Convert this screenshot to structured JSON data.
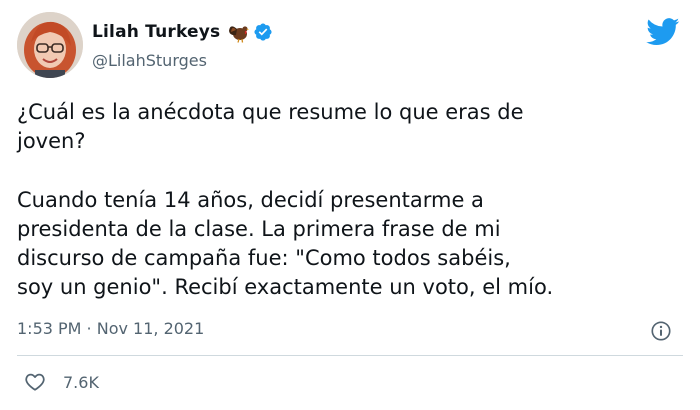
{
  "author": {
    "display_name": "Lilah Turkeys",
    "emoji_icon": "turkey-icon",
    "verified": true,
    "handle": "@LilahSturges"
  },
  "brand": {
    "icon": "twitter-bird-icon",
    "color": "#1d9bf0"
  },
  "tweet": {
    "paragraph1": [
      "¿Cuál es la anécdota que resume lo que eras de",
      "joven?"
    ],
    "paragraph2": [
      "Cuando tenía 14 años, decidí presentarme a",
      "presidenta de la clase. La primera frase de mi",
      "discurso de campaña fue: \"Como todos sabéis,",
      "soy un genio\". Recibí exactamente un voto, el mío."
    ],
    "timestamp": "1:53 PM · Nov 11, 2021"
  },
  "actions": {
    "like_icon": "heart-icon",
    "like_count": "7.6K",
    "info_icon": "info-icon"
  },
  "colors": {
    "text": "#0f1419",
    "secondary": "#536471",
    "divider": "#cfd9de",
    "verified": "#1d9bf0"
  }
}
